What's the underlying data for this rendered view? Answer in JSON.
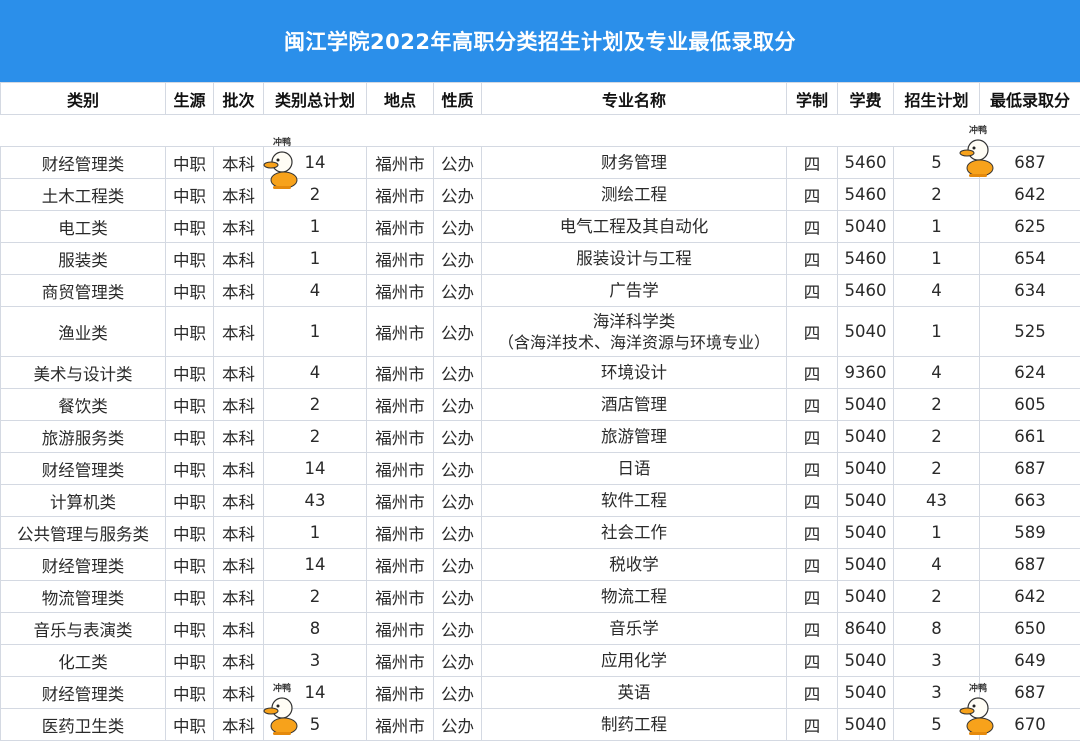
{
  "title": "闽江学院2022年高职分类招生计划及专业最低录取分",
  "headers": [
    "类别",
    "生源",
    "批次",
    "类别总计划",
    "地点",
    "性质",
    "专业名称",
    "学制",
    "学费",
    "招生计划",
    "最低录取分"
  ],
  "rows": [
    {
      "category": "财经管理类",
      "source": "中职",
      "batch": "本科",
      "total": "14",
      "location": "福州市",
      "nature": "公办",
      "major": "财务管理",
      "major_sub": "",
      "years": "四",
      "fee": "5460",
      "plan": "5",
      "score": "687"
    },
    {
      "category": "土木工程类",
      "source": "中职",
      "batch": "本科",
      "total": "2",
      "location": "福州市",
      "nature": "公办",
      "major": "测绘工程",
      "major_sub": "",
      "years": "四",
      "fee": "5460",
      "plan": "2",
      "score": "642"
    },
    {
      "category": "电工类",
      "source": "中职",
      "batch": "本科",
      "total": "1",
      "location": "福州市",
      "nature": "公办",
      "major": "电气工程及其自动化",
      "major_sub": "",
      "years": "四",
      "fee": "5040",
      "plan": "1",
      "score": "625"
    },
    {
      "category": "服装类",
      "source": "中职",
      "batch": "本科",
      "total": "1",
      "location": "福州市",
      "nature": "公办",
      "major": "服装设计与工程",
      "major_sub": "",
      "years": "四",
      "fee": "5460",
      "plan": "1",
      "score": "654"
    },
    {
      "category": "商贸管理类",
      "source": "中职",
      "batch": "本科",
      "total": "4",
      "location": "福州市",
      "nature": "公办",
      "major": "广告学",
      "major_sub": "",
      "years": "四",
      "fee": "5460",
      "plan": "4",
      "score": "634"
    },
    {
      "category": "渔业类",
      "source": "中职",
      "batch": "本科",
      "total": "1",
      "location": "福州市",
      "nature": "公办",
      "major": "海洋科学类",
      "major_sub": "（含海洋技术、海洋资源与环境专业）",
      "years": "四",
      "fee": "5040",
      "plan": "1",
      "score": "525"
    },
    {
      "category": "美术与设计类",
      "source": "中职",
      "batch": "本科",
      "total": "4",
      "location": "福州市",
      "nature": "公办",
      "major": "环境设计",
      "major_sub": "",
      "years": "四",
      "fee": "9360",
      "plan": "4",
      "score": "624"
    },
    {
      "category": "餐饮类",
      "source": "中职",
      "batch": "本科",
      "total": "2",
      "location": "福州市",
      "nature": "公办",
      "major": "酒店管理",
      "major_sub": "",
      "years": "四",
      "fee": "5040",
      "plan": "2",
      "score": "605"
    },
    {
      "category": "旅游服务类",
      "source": "中职",
      "batch": "本科",
      "total": "2",
      "location": "福州市",
      "nature": "公办",
      "major": "旅游管理",
      "major_sub": "",
      "years": "四",
      "fee": "5040",
      "plan": "2",
      "score": "661"
    },
    {
      "category": "财经管理类",
      "source": "中职",
      "batch": "本科",
      "total": "14",
      "location": "福州市",
      "nature": "公办",
      "major": "日语",
      "major_sub": "",
      "years": "四",
      "fee": "5040",
      "plan": "2",
      "score": "687"
    },
    {
      "category": "计算机类",
      "source": "中职",
      "batch": "本科",
      "total": "43",
      "location": "福州市",
      "nature": "公办",
      "major": "软件工程",
      "major_sub": "",
      "years": "四",
      "fee": "5040",
      "plan": "43",
      "score": "663"
    },
    {
      "category": "公共管理与服务类",
      "source": "中职",
      "batch": "本科",
      "total": "1",
      "location": "福州市",
      "nature": "公办",
      "major": "社会工作",
      "major_sub": "",
      "years": "四",
      "fee": "5040",
      "plan": "1",
      "score": "589"
    },
    {
      "category": "财经管理类",
      "source": "中职",
      "batch": "本科",
      "total": "14",
      "location": "福州市",
      "nature": "公办",
      "major": "税收学",
      "major_sub": "",
      "years": "四",
      "fee": "5040",
      "plan": "4",
      "score": "687"
    },
    {
      "category": "物流管理类",
      "source": "中职",
      "batch": "本科",
      "total": "2",
      "location": "福州市",
      "nature": "公办",
      "major": "物流工程",
      "major_sub": "",
      "years": "四",
      "fee": "5040",
      "plan": "2",
      "score": "642"
    },
    {
      "category": "音乐与表演类",
      "source": "中职",
      "batch": "本科",
      "total": "8",
      "location": "福州市",
      "nature": "公办",
      "major": "音乐学",
      "major_sub": "",
      "years": "四",
      "fee": "8640",
      "plan": "8",
      "score": "650"
    },
    {
      "category": "化工类",
      "source": "中职",
      "batch": "本科",
      "total": "3",
      "location": "福州市",
      "nature": "公办",
      "major": "应用化学",
      "major_sub": "",
      "years": "四",
      "fee": "5040",
      "plan": "3",
      "score": "649"
    },
    {
      "category": "财经管理类",
      "source": "中职",
      "batch": "本科",
      "total": "14",
      "location": "福州市",
      "nature": "公办",
      "major": "英语",
      "major_sub": "",
      "years": "四",
      "fee": "5040",
      "plan": "3",
      "score": "687"
    },
    {
      "category": "医药卫生类",
      "source": "中职",
      "batch": "本科",
      "total": "5",
      "location": "福州市",
      "nature": "公办",
      "major": "制药工程",
      "major_sub": "",
      "years": "四",
      "fee": "5040",
      "plan": "5",
      "score": "670"
    }
  ],
  "sticker_text": "冲鸭",
  "colors": {
    "title_bg": "#2b8fea",
    "title_text": "#ffffff",
    "grid": "#d4d9e2",
    "duck": "#f7a21b"
  }
}
